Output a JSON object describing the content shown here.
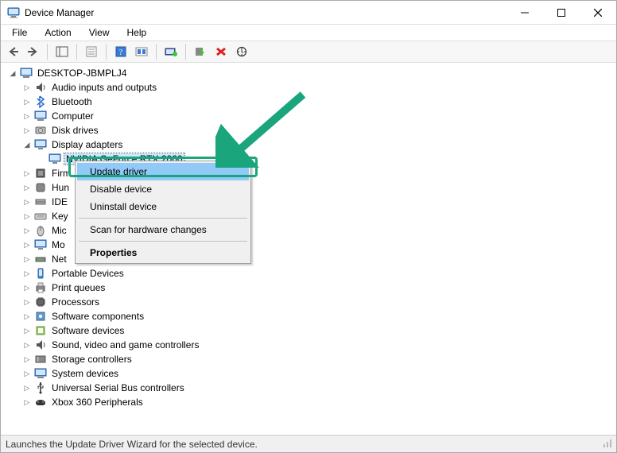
{
  "window": {
    "title": "Device Manager"
  },
  "menubar": {
    "file": "File",
    "action": "Action",
    "view": "View",
    "help": "Help"
  },
  "tree": {
    "root": {
      "label": "DESKTOP-JBMPLJ4",
      "expanded": true
    },
    "categories": [
      {
        "label": "Audio inputs and outputs",
        "expanded": false
      },
      {
        "label": "Bluetooth",
        "expanded": false
      },
      {
        "label": "Computer",
        "expanded": false
      },
      {
        "label": "Disk drives",
        "expanded": false
      },
      {
        "label": "Display adapters",
        "expanded": true,
        "children": [
          {
            "label": "NVIDIA GeForce RTX 2060",
            "selected": true
          }
        ]
      },
      {
        "label": "Firmware",
        "partial": "Firm",
        "expanded": false
      },
      {
        "label": "Human Interface Devices",
        "partial": "Hun",
        "expanded": false
      },
      {
        "label": "IDE ATA/ATAPI controllers",
        "partial": "IDE",
        "expanded": false
      },
      {
        "label": "Keyboards",
        "partial": "Key",
        "expanded": false
      },
      {
        "label": "Mice and other pointing devices",
        "partial": "Mic",
        "expanded": false
      },
      {
        "label": "Monitors",
        "partial": "Mo",
        "expanded": false
      },
      {
        "label": "Network adapters",
        "partial": "Net",
        "expanded": false
      },
      {
        "label": "Portable Devices",
        "expanded": false
      },
      {
        "label": "Print queues",
        "expanded": false
      },
      {
        "label": "Processors",
        "expanded": false
      },
      {
        "label": "Software components",
        "expanded": false
      },
      {
        "label": "Software devices",
        "expanded": false
      },
      {
        "label": "Sound, video and game controllers",
        "expanded": false
      },
      {
        "label": "Storage controllers",
        "expanded": false
      },
      {
        "label": "System devices",
        "expanded": false
      },
      {
        "label": "Universal Serial Bus controllers",
        "expanded": false
      },
      {
        "label": "Xbox 360 Peripherals",
        "expanded": false
      }
    ]
  },
  "context_menu": {
    "update_driver": "Update driver",
    "disable_device": "Disable device",
    "uninstall_device": "Uninstall device",
    "scan": "Scan for hardware changes",
    "properties": "Properties"
  },
  "statusbar": {
    "text": "Launches the Update Driver Wizard for the selected device."
  }
}
